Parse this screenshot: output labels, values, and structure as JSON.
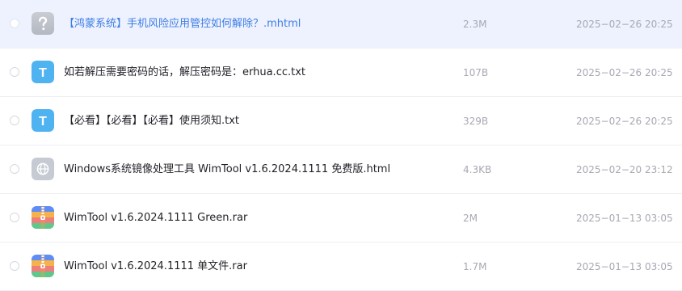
{
  "colors": {
    "accent": "#3d7de6",
    "row_selected_bg": "#eef2fe",
    "text_primary": "#212329",
    "text_secondary": "#a6a9b2"
  },
  "files": [
    {
      "name": "【鸿蒙系统】手机风险应用管控如何解除？.mhtml",
      "size": "2.3M",
      "date": "2025−02−26 20:25",
      "icon": "unknown-file-icon",
      "selected": true
    },
    {
      "name": "如若解压需要密码的话，解压密码是：erhua.cc.txt",
      "size": "107B",
      "date": "2025−02−26 20:25",
      "icon": "text-file-icon",
      "icon_letter": "T",
      "selected": false
    },
    {
      "name": "【必看】【必看】【必看】使用须知.txt",
      "size": "329B",
      "date": "2025−02−26 20:25",
      "icon": "text-file-icon",
      "icon_letter": "T",
      "selected": false
    },
    {
      "name": "Windows系统镜像处理工具 WimTool v1.6.2024.1111 免费版.html",
      "size": "4.3KB",
      "date": "2025−02−20 23:12",
      "icon": "web-file-icon",
      "selected": false
    },
    {
      "name": "WimTool v1.6.2024.1111 Green.rar",
      "size": "2M",
      "date": "2025−01−13 03:05",
      "icon": "archive-file-icon",
      "selected": false
    },
    {
      "name": "WimTool v1.6.2024.1111 单文件.rar",
      "size": "1.7M",
      "date": "2025−01−13 03:05",
      "icon": "archive-file-icon",
      "selected": false
    }
  ]
}
